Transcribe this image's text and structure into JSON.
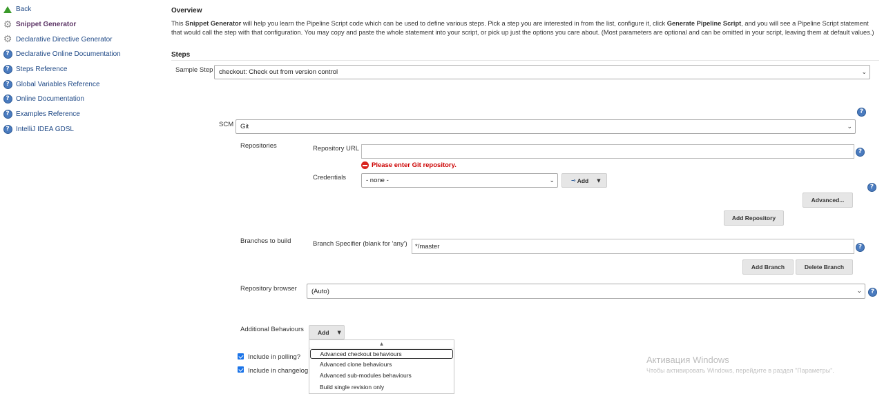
{
  "sidebar": {
    "items": [
      {
        "label": "Back",
        "icon": "up-arrow-icon"
      },
      {
        "label": "Snippet Generator",
        "icon": "gear-icon",
        "active": true
      },
      {
        "label": "Declarative Directive Generator",
        "icon": "gear-icon"
      },
      {
        "label": "Declarative Online Documentation",
        "icon": "help-icon"
      },
      {
        "label": "Steps Reference",
        "icon": "help-icon"
      },
      {
        "label": "Global Variables Reference",
        "icon": "help-icon"
      },
      {
        "label": "Online Documentation",
        "icon": "help-icon"
      },
      {
        "label": "Examples Reference",
        "icon": "help-icon"
      },
      {
        "label": "IntelliJ IDEA GDSL",
        "icon": "help-icon"
      }
    ]
  },
  "overview": {
    "title": "Overview",
    "text_1": "This ",
    "bold_1": "Snippet Generator",
    "text_2": " will help you learn the Pipeline Script code which can be used to define various steps. Pick a step you are interested in from the list, configure it, click ",
    "bold_2": "Generate Pipeline Script",
    "text_3": ", and you will see a Pipeline Script statement that would call the step with that configuration. You may copy and paste the whole statement into your script, or pick up just the options you care about. (Most parameters are optional and can be omitted in your script, leaving them at default values.)"
  },
  "steps": {
    "title": "Steps",
    "sample_step_label": "Sample Step",
    "sample_step_value": "checkout: Check out from version control"
  },
  "scm": {
    "label": "SCM",
    "value": "Git",
    "repositories_label": "Repositories",
    "repo_url_label": "Repository URL",
    "repo_url_value": "",
    "repo_error": "Please enter Git repository.",
    "credentials_label": "Credentials",
    "credentials_value": "- none -",
    "add_label": "Add",
    "advanced_label": "Advanced...",
    "add_repository_label": "Add Repository",
    "branches_label": "Branches to build",
    "branch_specifier_label": "Branch Specifier (blank for 'any')",
    "branch_specifier_value": "*/master",
    "add_branch_label": "Add Branch",
    "delete_branch_label": "Delete Branch",
    "repo_browser_label": "Repository browser",
    "repo_browser_value": "(Auto)",
    "additional_behaviours_label": "Additional Behaviours",
    "add_behaviour_label": "Add",
    "include_polling_label": "Include in polling?",
    "include_changelog_label": "Include in changelog"
  },
  "behaviours_menu": {
    "items": [
      "Advanced checkout behaviours",
      "Advanced clone behaviours",
      "Advanced sub-modules behaviours",
      "Build single revision only"
    ],
    "selected_index": 0
  },
  "watermark": {
    "title": "Активация Windows",
    "subtitle": "Чтобы активировать Windows, перейдите в раздел \"Параметры\"."
  }
}
